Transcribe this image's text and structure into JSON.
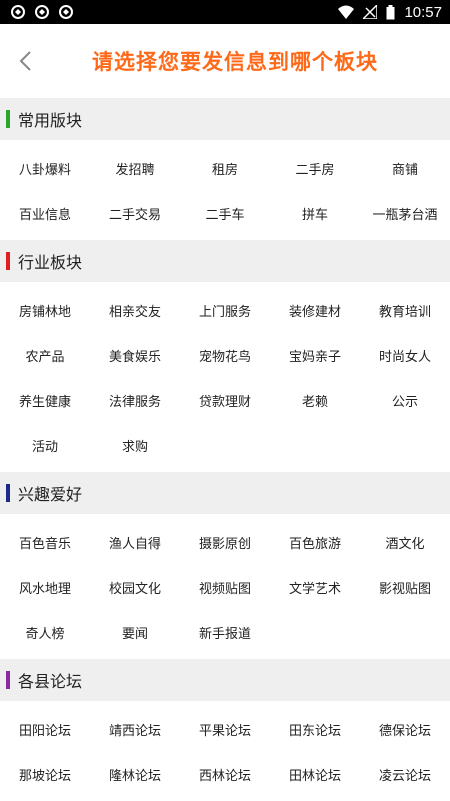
{
  "status_bar": {
    "time": "10:57"
  },
  "header": {
    "title": "请选择您要发信息到哪个板块"
  },
  "colors": {
    "title": "#ff6a1a",
    "common": "#2aa52a",
    "industry": "#e02020",
    "interest": "#1e2a8a",
    "county": "#8a2aa0"
  },
  "sections": [
    {
      "title": "常用版块",
      "items": [
        "八卦爆料",
        "发招聘",
        "租房",
        "二手房",
        "商铺",
        "百业信息",
        "二手交易",
        "二手车",
        "拼车",
        "一瓶茅台酒"
      ]
    },
    {
      "title": "行业板块",
      "items": [
        "房铺林地",
        "相亲交友",
        "上门服务",
        "装修建材",
        "教育培训",
        "农产品",
        "美食娱乐",
        "宠物花鸟",
        "宝妈亲子",
        "时尚女人",
        "养生健康",
        "法律服务",
        "贷款理财",
        "老赖",
        "公示",
        "活动",
        "求购"
      ]
    },
    {
      "title": "兴趣爱好",
      "items": [
        "百色音乐",
        "渔人自得",
        "摄影原创",
        "百色旅游",
        "酒文化",
        "风水地理",
        "校园文化",
        "视频贴图",
        "文学艺术",
        "影视贴图",
        "奇人榜",
        "要闻",
        "新手报道"
      ]
    },
    {
      "title": "各县论坛",
      "items": [
        "田阳论坛",
        "靖西论坛",
        "平果论坛",
        "田东论坛",
        "德保论坛",
        "那坡论坛",
        "隆林论坛",
        "西林论坛",
        "田林论坛",
        "凌云论坛"
      ]
    }
  ]
}
